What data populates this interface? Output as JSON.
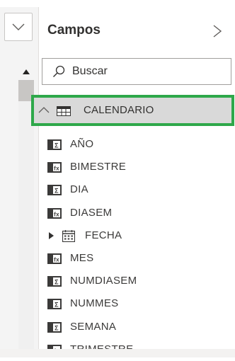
{
  "pane": {
    "title": "Campos",
    "search_placeholder": "Buscar"
  },
  "table": {
    "name": "CALENDARIO",
    "highlight_color": "#2ea84a"
  },
  "fields": [
    {
      "label": "AÑO",
      "icon": "numeric-field-icon"
    },
    {
      "label": "BIMESTRE",
      "icon": "text-field-icon"
    },
    {
      "label": "DIA",
      "icon": "numeric-field-icon"
    },
    {
      "label": "DIASEM",
      "icon": "text-field-icon"
    },
    {
      "label": "FECHA",
      "icon": "date-hierarchy-icon"
    },
    {
      "label": "MES",
      "icon": "text-field-icon"
    },
    {
      "label": "NUMDIASEM",
      "icon": "numeric-field-icon"
    },
    {
      "label": "NUMMES",
      "icon": "numeric-field-icon"
    },
    {
      "label": "SEMANA",
      "icon": "numeric-field-icon"
    },
    {
      "label": "TRIMESTRE",
      "icon": "text-field-icon"
    }
  ]
}
